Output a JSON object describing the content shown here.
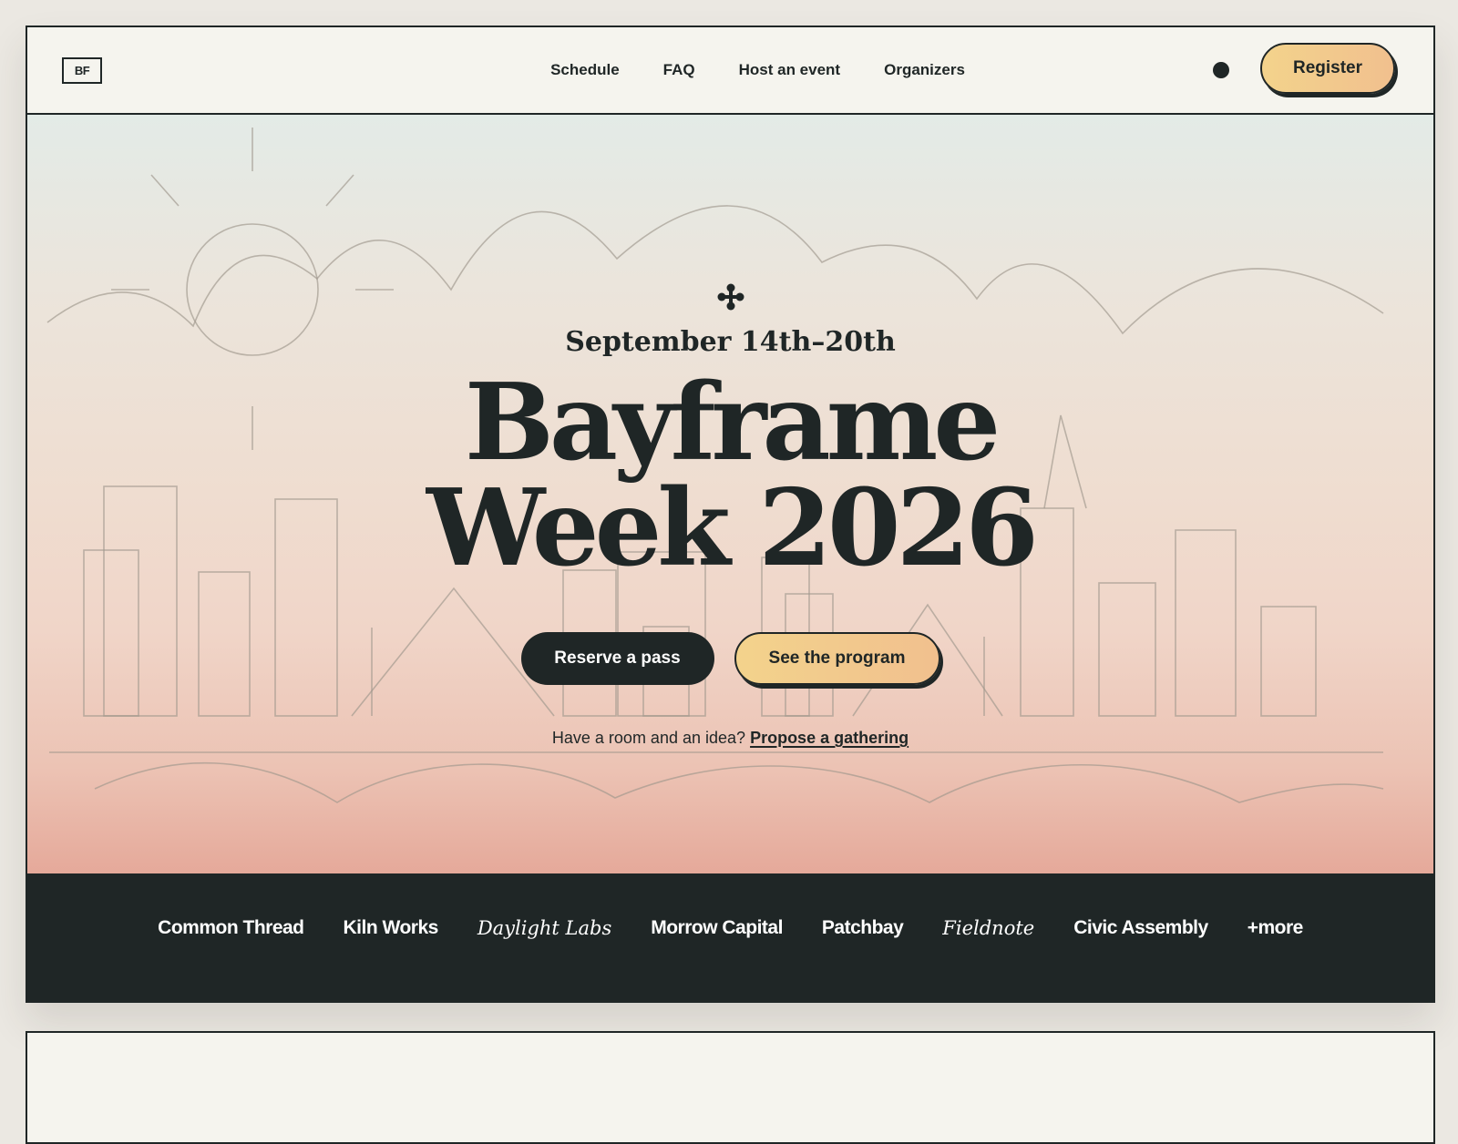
{
  "navbar": {
    "logo": "BF",
    "links": [
      "Schedule",
      "FAQ",
      "Host an event",
      "Organizers"
    ],
    "theme_toggle_icon": "circle-icon",
    "register_label": "Register"
  },
  "hero": {
    "decoration_icon": "sparkle-icon",
    "dates": "September 14th–20th",
    "title_line1": "Bayframe",
    "title_line2": "Week 2026",
    "primary_cta": "Reserve a pass",
    "secondary_cta": "See the program",
    "propose_prefix": "Have a room and an idea?",
    "propose_link": "Propose a gathering"
  },
  "sponsors": {
    "items": [
      {
        "label": "Common Thread",
        "style": "sans"
      },
      {
        "label": "Kiln Works",
        "style": "sans"
      },
      {
        "label": "Daylight Labs",
        "style": "serif-italic"
      },
      {
        "label": "Morrow Capital",
        "style": "sans"
      },
      {
        "label": "Patchbay",
        "style": "sans"
      },
      {
        "label": "Fieldnote",
        "style": "serif-italic"
      },
      {
        "label": "Civic Assembly",
        "style": "sans"
      },
      {
        "label": "+more",
        "style": "sans"
      }
    ]
  },
  "colors": {
    "ink": "#1f2626",
    "paper": "#f5f4ee",
    "gold_start": "#f3d38c",
    "gold_end": "#f1c08e",
    "hero_top": "#e3ebe7",
    "hero_bottom": "#e5a99a"
  }
}
